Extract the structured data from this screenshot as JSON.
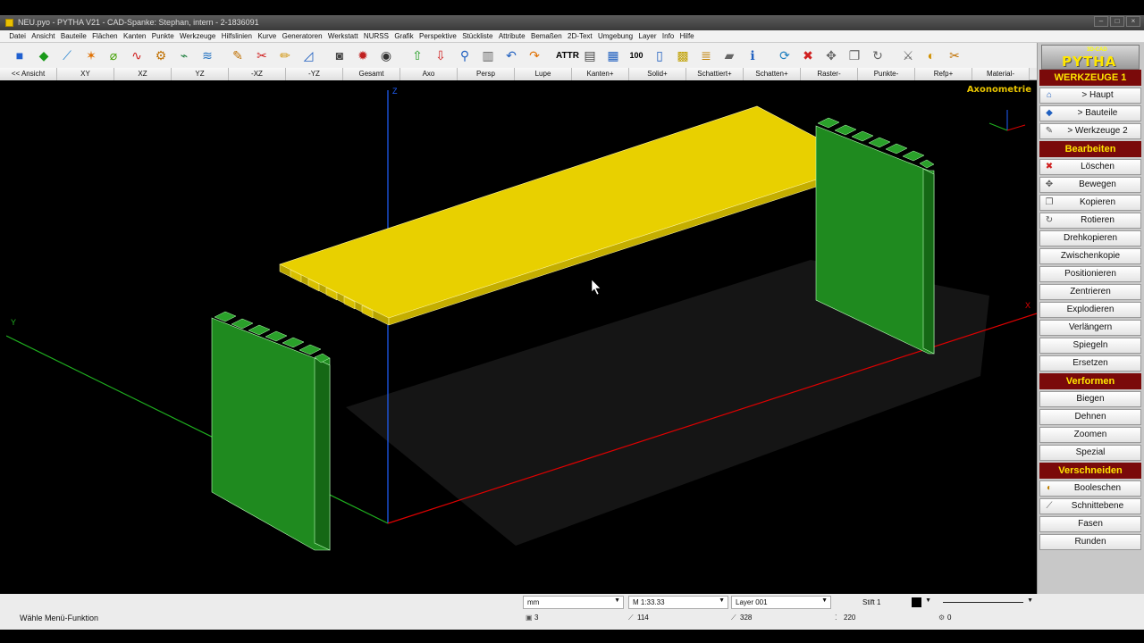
{
  "window": {
    "title": "NEU.pyo - PYTHA V21 - CAD-Spanke: Stephan, intern - 2-1836091"
  },
  "menu": [
    "Datei",
    "Ansicht",
    "Bauteile",
    "Flächen",
    "Kanten",
    "Punkte",
    "Werkzeuge",
    "Hilfslinien",
    "Kurve",
    "Generatoren",
    "Werkstatt",
    "NURSS",
    "Grafik",
    "Perspektive",
    "Stückliste",
    "Attribute",
    "Bemaßen",
    "2D-Text",
    "Umgebung",
    "Layer",
    "Info",
    "Hilfe"
  ],
  "view_buttons": [
    "<< Ansicht",
    "XY",
    "XZ",
    "YZ",
    "-XZ",
    "-YZ",
    "Gesamt",
    "Axo",
    "Persp",
    "Lupe",
    "Kanten+",
    "Solid+",
    "Schattiert+",
    "Schatten+",
    "Raster-",
    "Punkte-",
    "Refp+",
    "Material-"
  ],
  "viewport": {
    "view_name": "Axonometrie",
    "axis_z": "Z",
    "axis_y": "Y",
    "axis_x": "X",
    "colors": {
      "plate": "#e8d000",
      "side": "#1f8a1f",
      "axis_x": "#e00000",
      "axis_y": "#1fb01f",
      "axis_z": "#2060ff"
    }
  },
  "sidebar": {
    "logo_small": "3D-CAD",
    "logo_big": "PYTHA",
    "title": "WERKZEUGE 1",
    "nav": [
      {
        "label": "> Haupt",
        "icon": "home-icon"
      },
      {
        "label": "> Bauteile",
        "icon": "parts-icon"
      },
      {
        "label": "> Werkzeuge 2",
        "icon": "tools-icon"
      }
    ],
    "section_edit": "Bearbeiten",
    "edit": [
      {
        "label": "Löschen",
        "icon": "delete-icon"
      },
      {
        "label": "Bewegen",
        "icon": "move-icon"
      },
      {
        "label": "Kopieren",
        "icon": "copy-icon"
      },
      {
        "label": "Rotieren",
        "icon": "rotate-icon"
      },
      {
        "label": "Drehkopieren"
      },
      {
        "label": "Zwischenkopie"
      },
      {
        "label": "Positionieren"
      },
      {
        "label": "Zentrieren"
      },
      {
        "label": "Explodieren"
      },
      {
        "label": "Verlängern"
      },
      {
        "label": "Spiegeln"
      },
      {
        "label": "Ersetzen"
      }
    ],
    "section_deform": "Verformen",
    "deform": [
      "Biegen",
      "Dehnen",
      "Zoomen",
      "Spezial"
    ],
    "section_cut": "Verschneiden",
    "cut": [
      {
        "label": "Booleschen",
        "icon": "boolean-icon"
      },
      {
        "label": "Schnittebene",
        "icon": "cutplane-icon"
      },
      {
        "label": "Fasen"
      },
      {
        "label": "Runden"
      }
    ]
  },
  "status": {
    "unit": "mm",
    "scale": "M 1:33.33",
    "layer": "Layer 001",
    "pen": "Stift 1",
    "message": "Wähle Menü-Funktion",
    "count_parts": "3",
    "count_a": "114",
    "count_b": "328",
    "count_c": "220",
    "count_d": "0"
  }
}
